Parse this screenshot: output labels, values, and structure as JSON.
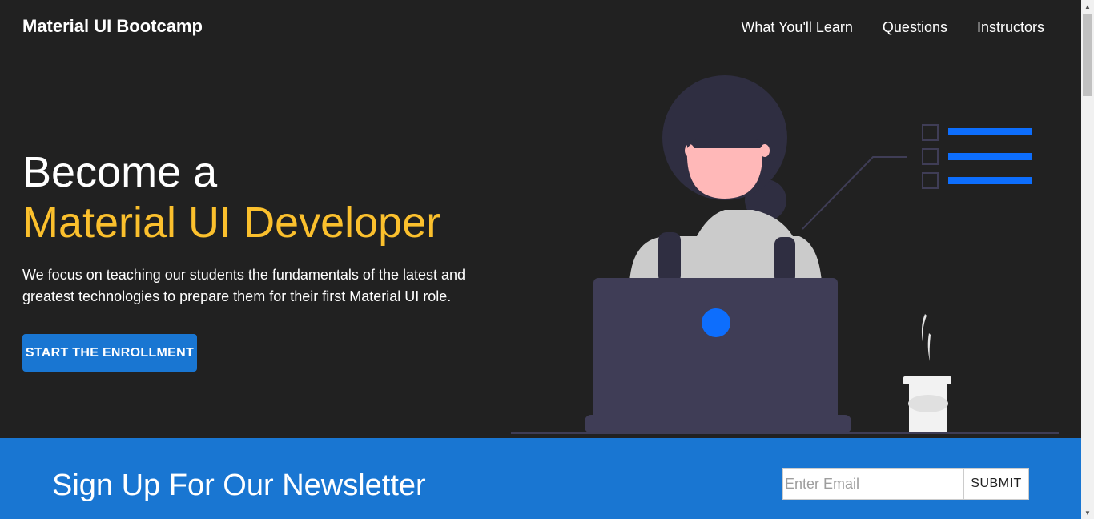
{
  "navbar": {
    "brand": "Material UI Bootcamp",
    "links": [
      "What You'll Learn",
      "Questions",
      "Instructors"
    ]
  },
  "hero": {
    "title_line1": "Become a",
    "title_line2": "Material UI Developer",
    "description": "We focus on teaching our students the fundamentals of the latest and greatest technologies to prepare them for their first Material UI role.",
    "cta_label": "START THE ENROLLMENT"
  },
  "newsletter": {
    "title": "Sign Up For Our Newsletter",
    "email_placeholder": "Enter Email",
    "submit_label": "SUBMIT"
  },
  "colors": {
    "background": "#212121",
    "accent_yellow": "#fbc02d",
    "primary_blue": "#1976d2"
  },
  "icons": {
    "illustration": "developer-at-laptop-illustration",
    "scroll_up": "scroll-up-arrow-icon",
    "scroll_down": "scroll-down-arrow-icon"
  }
}
